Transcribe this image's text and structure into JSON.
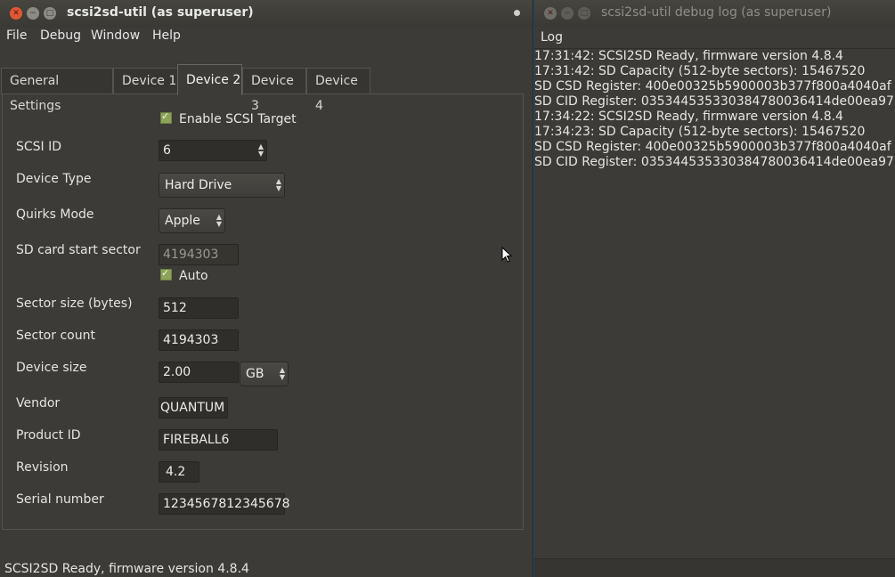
{
  "main_window": {
    "title": "scsi2sd-util (as superuser)",
    "menu": [
      "File",
      "Debug",
      "Window",
      "Help"
    ],
    "tabs": [
      "General Settings",
      "Device 1",
      "Device 2",
      "Device 3",
      "Device 4"
    ],
    "active_tab": "Device 2",
    "form": {
      "enable_label": "Enable SCSI Target",
      "scsi_id_label": "SCSI ID",
      "scsi_id_value": "6",
      "device_type_label": "Device Type",
      "device_type_value": "Hard Drive",
      "quirks_label": "Quirks Mode",
      "quirks_value": "Apple",
      "start_sector_label": "SD card start sector",
      "start_sector_value": "4194303",
      "auto_label": "Auto",
      "sector_size_label": "Sector size (bytes)",
      "sector_size_value": "512",
      "sector_count_label": "Sector count",
      "sector_count_value": "4194303",
      "device_size_label": "Device size",
      "device_size_value": "2.00",
      "device_size_unit": "GB",
      "vendor_label": "Vendor",
      "vendor_value": "QUANTUM",
      "product_label": "Product ID",
      "product_value": "FIREBALL6",
      "revision_label": "Revision",
      "revision_value": "4.2",
      "serial_label": "Serial number",
      "serial_value": "1234567812345678"
    },
    "status": "SCSI2SD Ready, firmware version 4.8.4"
  },
  "log_window": {
    "title": "scsi2sd-util debug log (as superuser)",
    "menu": [
      "Log"
    ],
    "lines": [
      "17:31:42: SCSI2SD Ready, firmware version 4.8.4",
      "17:31:42: SD Capacity (512-byte sectors): 15467520",
      "SD CSD Register: 400e00325b5900003b377f800a4040af",
      "SD CID Register: 035344535330384780036414de00ea97",
      "17:34:22: SCSI2SD Ready, firmware version 4.8.4",
      "17:34:23: SD Capacity (512-byte sectors): 15467520",
      "SD CSD Register: 400e00325b5900003b377f800a4040af",
      "SD CID Register: 035344535330384780036414de00ea97"
    ]
  },
  "colors": {
    "desktop": "#1f4a66",
    "window_bg": "#3c3b37",
    "close_button": "#e05833",
    "checkbox": "#8da35a"
  }
}
